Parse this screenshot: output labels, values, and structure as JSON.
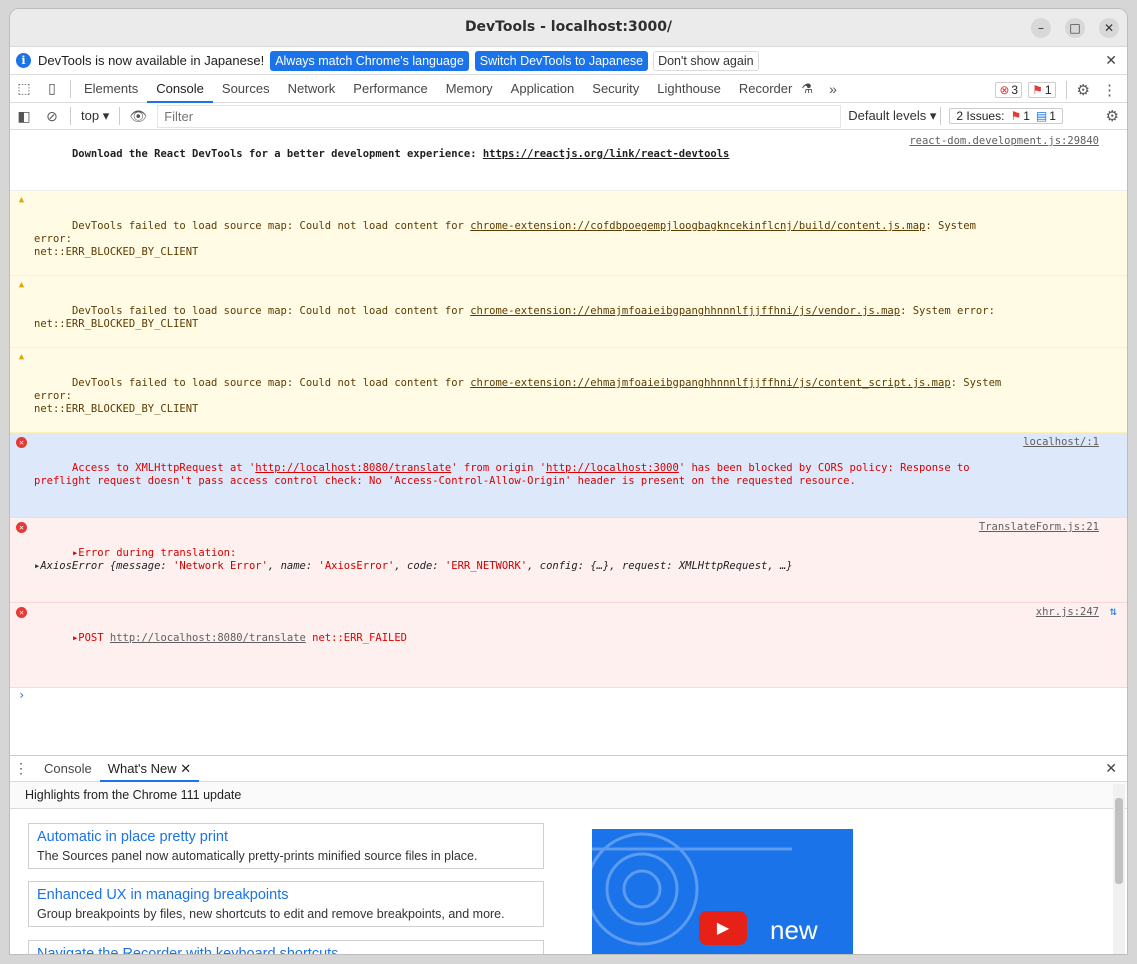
{
  "window": {
    "title": "DevTools - localhost:3000/"
  },
  "infobar": {
    "message": "DevTools is now available in Japanese!",
    "btn_match": "Always match Chrome's language",
    "btn_switch": "Switch DevTools to Japanese",
    "btn_dismiss": "Don't show again"
  },
  "tabs": [
    "Elements",
    "Console",
    "Sources",
    "Network",
    "Performance",
    "Memory",
    "Application",
    "Security",
    "Lighthouse",
    "Recorder"
  ],
  "active_tab": "Console",
  "counts": {
    "errors": "3",
    "issues_flag": "1"
  },
  "toolbar": {
    "context": "top",
    "filter_placeholder": "Filter",
    "levels": "Default levels",
    "issues_label": "2 Issues:",
    "issues_err": "1",
    "issues_info": "1"
  },
  "messages": {
    "m0": {
      "text_a": "Download the React DevTools for a better development experience: ",
      "link": "https://reactjs.org/link/react-devtools",
      "src": "react-dom.development.js:29840"
    },
    "m1": {
      "text_a": "DevTools failed to load source map: Could not load content for ",
      "link": "chrome-extension://cofdbpoegempjloogbagkncekinflcnj/build/content.js.map",
      "text_b": ": System error:\nnet::ERR_BLOCKED_BY_CLIENT"
    },
    "m2": {
      "text_a": "DevTools failed to load source map: Could not load content for ",
      "link": "chrome-extension://ehmajmfoaieibgpanghhnnnlfjjffhni/js/vendor.js.map",
      "text_b": ": System error:\nnet::ERR_BLOCKED_BY_CLIENT"
    },
    "m3": {
      "text_a": "DevTools failed to load source map: Could not load content for ",
      "link": "chrome-extension://ehmajmfoaieibgpanghhnnnlfjjffhni/js/content_script.js.map",
      "text_b": ": System error:\nnet::ERR_BLOCKED_BY_CLIENT"
    },
    "m4": {
      "text_a": "Access to XMLHttpRequest at '",
      "link1": "http://localhost:8080/translate",
      "text_b": "' from origin '",
      "link2": "http://localhost:3000",
      "text_c": "' has been blocked by CORS policy: Response to\npreflight request doesn't pass access control check: No 'Access-Control-Allow-Origin' header is present on the requested resource.",
      "src": "localhost/:1"
    },
    "m5": {
      "line1": "Error during translation:",
      "obj_a": "AxiosError {message: ",
      "v1": "'Network Error'",
      "obj_b": ", name: ",
      "v2": "'AxiosError'",
      "obj_c": ", code: ",
      "v3": "'ERR_NETWORK'",
      "obj_d": ", config: {…}, request: XMLHttpRequest, …}",
      "src": "TranslateForm.js:21"
    },
    "m6": {
      "method": "POST ",
      "link": "http://localhost:8080/translate",
      "status": " net::ERR_FAILED",
      "src": "xhr.js:247"
    }
  },
  "drawer": {
    "tab_console": "Console",
    "tab_whatsnew": "What's New",
    "highlights": "Highlights from the Chrome 111 update",
    "cards": [
      {
        "title": "Automatic in place pretty print",
        "desc": "The Sources panel now automatically pretty-prints minified source files in place."
      },
      {
        "title": "Enhanced UX in managing breakpoints",
        "desc": "Group breakpoints by files, new shortcuts to edit and remove breakpoints, and more."
      },
      {
        "title": "Navigate the Recorder with keyboard shortcuts",
        "desc": ""
      }
    ],
    "thumb_text": "new"
  }
}
